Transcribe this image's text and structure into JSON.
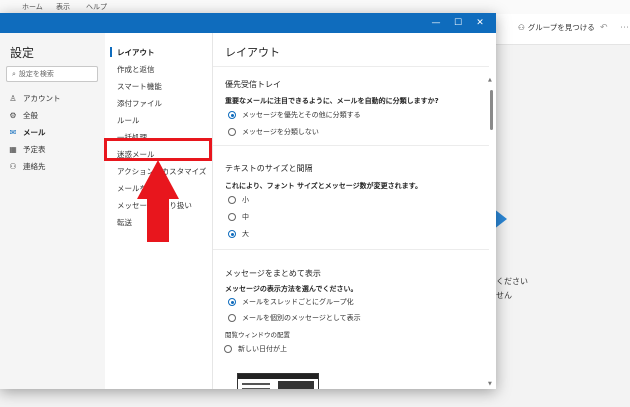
{
  "background": {
    "menu": [
      "ホーム",
      "表示",
      "ヘルプ"
    ],
    "group_button": "グループを見つける",
    "right_text_1": "ください",
    "right_text_2": "せん"
  },
  "nav": {
    "title": "設定",
    "search_placeholder": "設定を検索",
    "items": [
      {
        "label": "アカウント",
        "icon": "person-icon"
      },
      {
        "label": "全般",
        "icon": "gear-icon"
      },
      {
        "label": "メール",
        "icon": "mail-icon",
        "active": true
      },
      {
        "label": "予定表",
        "icon": "calendar-icon"
      },
      {
        "label": "連絡先",
        "icon": "people-icon"
      }
    ]
  },
  "sub": {
    "items": [
      "レイアウト",
      "作成と返信",
      "スマート機能",
      "添付ファイル",
      "ルール",
      "一括処理",
      "迷惑メール",
      "アクションのカスタマイズ",
      "メールを同期",
      "メッセージの取り扱い",
      "転送"
    ]
  },
  "content": {
    "title": "レイアウト",
    "sections": [
      {
        "title": "優先受信トレイ",
        "question": "重要なメールに注目できるように、メールを自動的に分類しますか?",
        "options": [
          "メッセージを優先とその他に分類する",
          "メッセージを分類しない"
        ],
        "selected": 0
      },
      {
        "title": "テキストのサイズと間隔",
        "question": "これにより、フォント サイズとメッセージ数が変更されます。",
        "options": [
          "小",
          "中",
          "大"
        ],
        "selected": 2
      },
      {
        "title": "メッセージをまとめて表示",
        "question": "メッセージの表示方法を選んでください。",
        "options": [
          "メールをスレッドごとにグループ化",
          "メールを個別のメッセージとして表示"
        ],
        "selected": 0
      }
    ],
    "reading_pane_label": "閲覧ウィンドウの配置",
    "reading_pane_option": "新しい日付が上"
  },
  "colors": {
    "accent": "#0f6cbd",
    "highlight": "#e8161d"
  }
}
